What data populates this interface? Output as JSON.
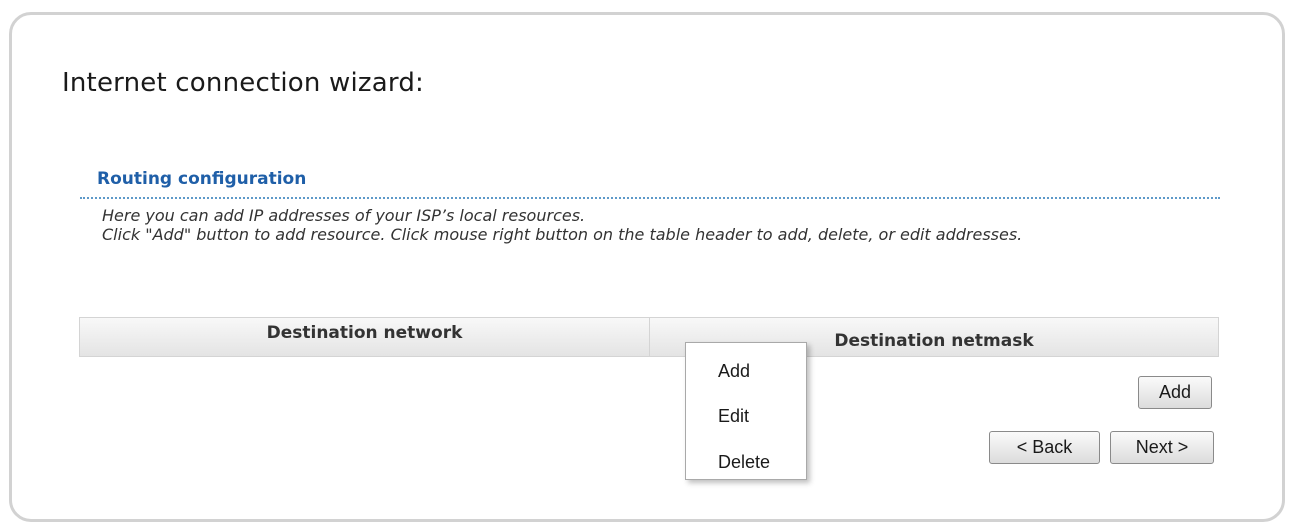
{
  "wizard": {
    "title": "Internet connection wizard:"
  },
  "section": {
    "title": "Routing configuration",
    "description": [
      "Here you can add IP addresses of your ISP’s local resources.",
      "Click \"Add\" button to add resource. Click mouse right button on the table header to add, delete, or edit addresses."
    ]
  },
  "table": {
    "columns": [
      "Destination network",
      "Destination netmask"
    ],
    "rows": []
  },
  "context_menu": {
    "items": [
      "Add",
      "Edit",
      "Delete"
    ]
  },
  "buttons": {
    "add_label": "Add",
    "back_label": "< Back",
    "next_label": "Next >"
  }
}
